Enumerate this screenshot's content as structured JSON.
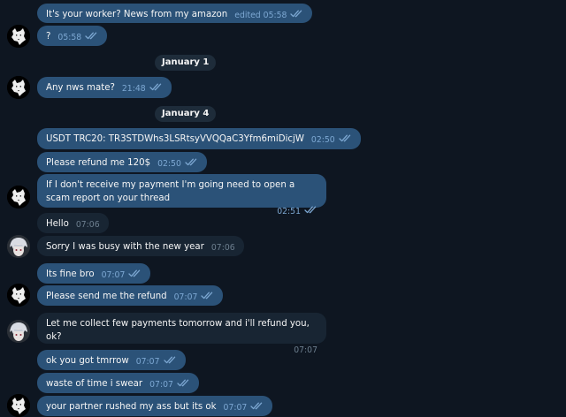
{
  "messages": [
    {
      "id": "m1",
      "dir": "out",
      "text": "It's your worker? News from my amazon",
      "time": "edited 05:58",
      "checks": true
    },
    {
      "id": "m2",
      "dir": "out",
      "text": "?",
      "time": "05:58",
      "checks": true
    },
    {
      "id": "m3",
      "dir": "out",
      "text": "Any nws mate?",
      "time": "21:48",
      "checks": true
    },
    {
      "id": "m4",
      "dir": "out",
      "text": "USDT TRC20: TR3STDWhs3LSRtsyVVQQaC3Yfm6miDicjW",
      "time": "02:50",
      "checks": true
    },
    {
      "id": "m5",
      "dir": "out",
      "text": "Please refund me 120$",
      "time": "02:50",
      "checks": true
    },
    {
      "id": "m6",
      "dir": "out",
      "text": "If I don't receive my payment I'm going need to open a scam report on your thread",
      "time": "02:51",
      "checks": true
    },
    {
      "id": "m7",
      "dir": "in",
      "text": "Hello",
      "time": "07:06",
      "checks": false
    },
    {
      "id": "m8",
      "dir": "in",
      "text": "Sorry I was busy with the new year",
      "time": "07:06",
      "checks": false
    },
    {
      "id": "m9",
      "dir": "out",
      "text": "Its fine bro",
      "time": "07:07",
      "checks": true
    },
    {
      "id": "m10",
      "dir": "out",
      "text": "Please send me the refund",
      "time": "07:07",
      "checks": true
    },
    {
      "id": "m11",
      "dir": "in",
      "text": "Let me collect few payments tomorrow and i'll refund you, ok?",
      "time": "07:07",
      "checks": false
    },
    {
      "id": "m12",
      "dir": "out",
      "text": "ok you got tmrrow",
      "time": "07:07",
      "checks": true
    },
    {
      "id": "m13",
      "dir": "out",
      "text": "waste of time i swear",
      "time": "07:07",
      "checks": true
    },
    {
      "id": "m14",
      "dir": "out",
      "text": "your partner rushed my ass but its ok",
      "time": "07:07",
      "checks": true
    }
  ],
  "date_separators": [
    {
      "label": "January 1"
    },
    {
      "label": "January 4"
    }
  ],
  "colors": {
    "background": "#0e1621",
    "outgoing_bubble": "#2b5278",
    "incoming_bubble": "#182533",
    "read_checks": "#7da8d3"
  },
  "icons": {
    "read_receipt": "double-check-icon",
    "sender_avatar": "wolf-avatar",
    "partner_avatar": "anime-avatar"
  }
}
